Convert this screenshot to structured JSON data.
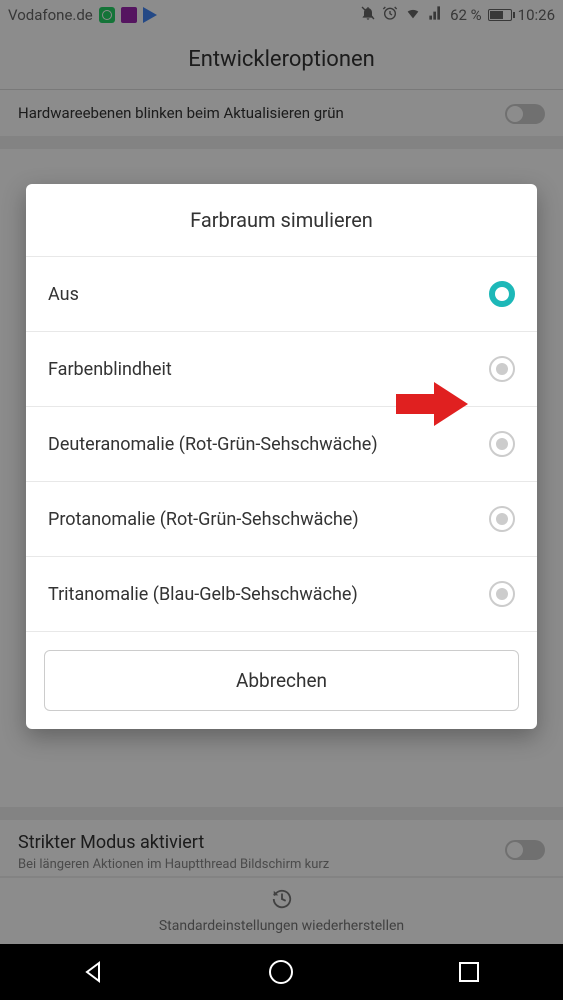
{
  "status_bar": {
    "carrier": "Vodafone.de",
    "battery_pct": "62 %",
    "time": "10:26"
  },
  "app_bar": {
    "title": "Entwickleroptionen"
  },
  "background": {
    "row_hw_layers": "Hardwareebenen blinken beim Aktualisieren grün",
    "strict_mode_title": "Strikter Modus aktiviert",
    "strict_mode_sub": "Bei längeren Aktionen im Hauptthread Bildschirm kurz",
    "restore_defaults": "Standardeinstellungen wiederherstellen"
  },
  "dialog": {
    "title": "Farbraum simulieren",
    "options": [
      {
        "label": "Aus",
        "selected": true
      },
      {
        "label": "Farbenblindheit",
        "selected": false
      },
      {
        "label": "Deuteranomalie (Rot-Grün-Sehschwäche)",
        "selected": false
      },
      {
        "label": "Protanomalie (Rot-Grün-Sehschwäche)",
        "selected": false
      },
      {
        "label": "Tritanomalie (Blau-Gelb-Sehschwäche)",
        "selected": false
      }
    ],
    "cancel": "Abbrechen"
  }
}
